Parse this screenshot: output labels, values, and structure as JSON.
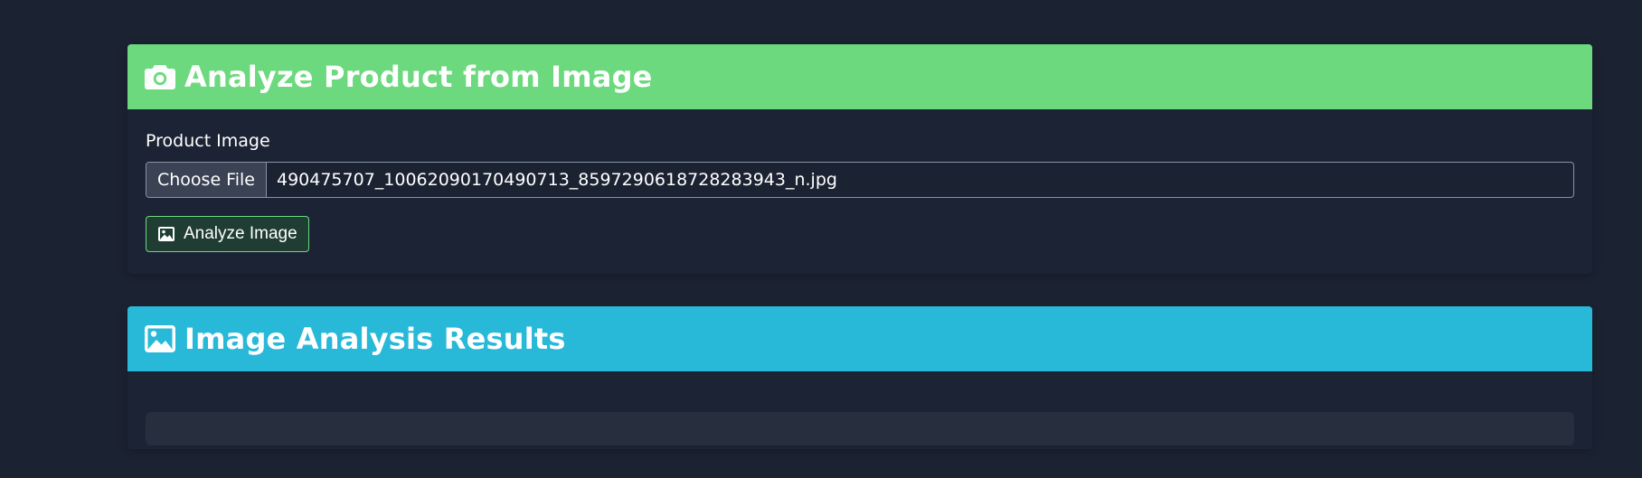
{
  "upload_card": {
    "title": "Analyze Product from Image",
    "icon": "camera-icon",
    "header_color": "#6cd97e",
    "field_label": "Product Image",
    "choose_file_label": "Choose File",
    "file_name": "490475707_10062090170490713_8597290618728283943_n.jpg",
    "analyze_button_label": "Analyze Image",
    "analyze_button_icon": "image-icon"
  },
  "results_card": {
    "title": "Image Analysis Results",
    "icon": "image-icon",
    "header_color": "#28b9d9",
    "content": ""
  }
}
